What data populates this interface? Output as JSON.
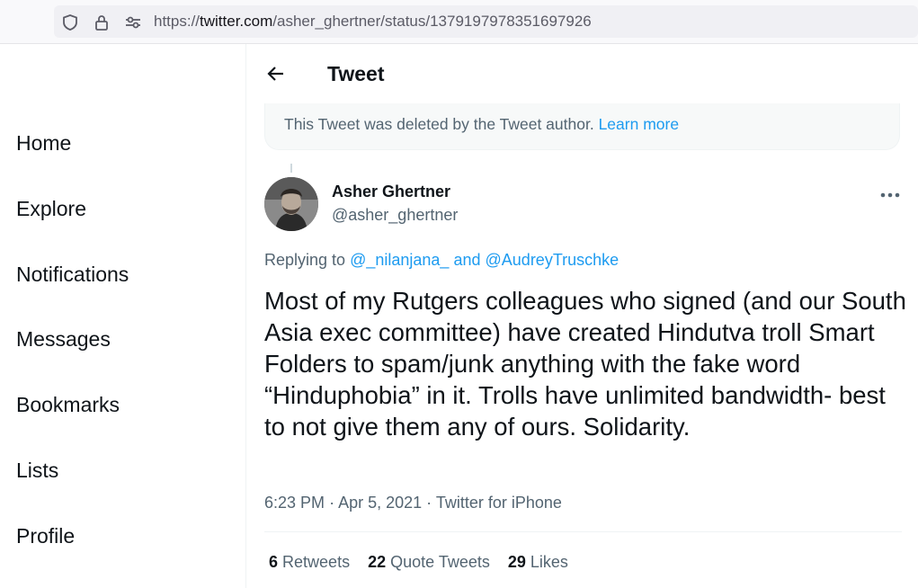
{
  "browser": {
    "url_prefix": "https://",
    "url_host": "twitter.com",
    "url_path": "/asher_ghertner/status/1379197978351697926"
  },
  "sidebar": {
    "items": [
      {
        "label": "Home"
      },
      {
        "label": "Explore"
      },
      {
        "label": "Notifications"
      },
      {
        "label": "Messages"
      },
      {
        "label": "Bookmarks"
      },
      {
        "label": "Lists"
      },
      {
        "label": "Profile"
      }
    ]
  },
  "header": {
    "title": "Tweet"
  },
  "notice": {
    "text": "This Tweet was deleted by the Tweet author.",
    "link": "Learn more"
  },
  "tweet": {
    "author_name": "Asher Ghertner",
    "author_handle": "@asher_ghertner",
    "replying_prefix": "Replying to",
    "mention_1": "@_nilanjana_",
    "mention_joiner": "and",
    "mention_2": "@AudreyTruschke",
    "text": "Most of my Rutgers colleagues who signed (and our South Asia exec committee) have created Hindutva troll Smart Folders to spam/junk anything with the fake word “Hinduphobia” in it. Trolls have unlimited bandwidth- best to not give them any of ours. Solidarity.",
    "time": "6:23 PM",
    "date": "Apr 5, 2021",
    "source": "Twitter for iPhone",
    "separator": "·"
  },
  "stats": {
    "retweets_count": "6",
    "retweets_label": "Retweets",
    "quotes_count": "22",
    "quotes_label": "Quote Tweets",
    "likes_count": "29",
    "likes_label": "Likes"
  },
  "colors": {
    "accent": "#1d9bf0",
    "text": "#0f1419",
    "secondary_text": "#536471"
  },
  "icons": [
    "shield-icon",
    "lock-icon",
    "permissions-icon",
    "back-arrow-icon",
    "more-options-icon"
  ]
}
